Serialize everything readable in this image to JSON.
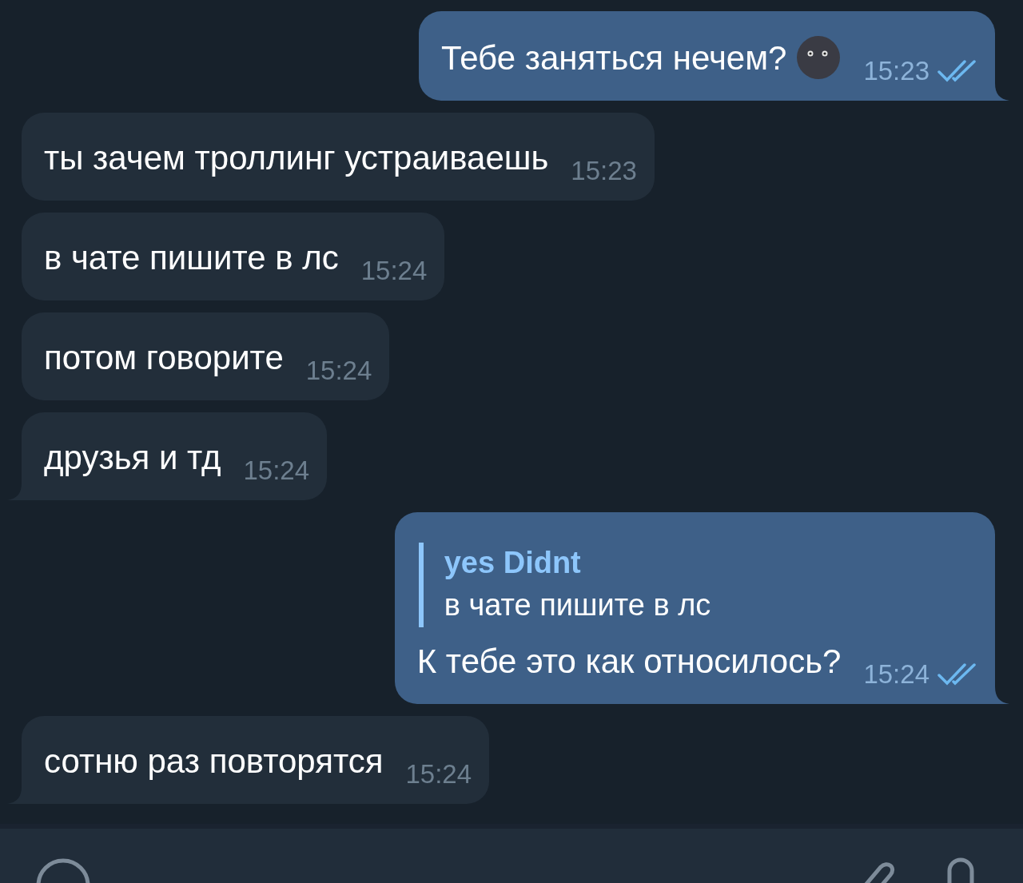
{
  "messages": [
    {
      "kind": "outgoing",
      "text": "Тебе заняться нечем?",
      "emoji": true,
      "time": "15:23",
      "read": true,
      "tail": true
    },
    {
      "kind": "incoming",
      "text": "ты зачем троллинг устраиваешь",
      "time": "15:23",
      "tail": false
    },
    {
      "kind": "incoming",
      "text": "в чате пишите в лс",
      "time": "15:24",
      "tail": false
    },
    {
      "kind": "incoming",
      "text": "потом говорите",
      "time": "15:24",
      "tail": false
    },
    {
      "kind": "incoming",
      "text": "друзья и тд",
      "time": "15:24",
      "tail": true
    },
    {
      "kind": "outgoing",
      "reply": {
        "author": "yes Didnt",
        "text": "в чате пишите в лс"
      },
      "text": "К тебе это как относилось?",
      "time": "15:24",
      "read": true,
      "tail": true
    },
    {
      "kind": "incoming",
      "text": "сотню раз повторятся",
      "time": "15:24",
      "tail": true
    }
  ]
}
